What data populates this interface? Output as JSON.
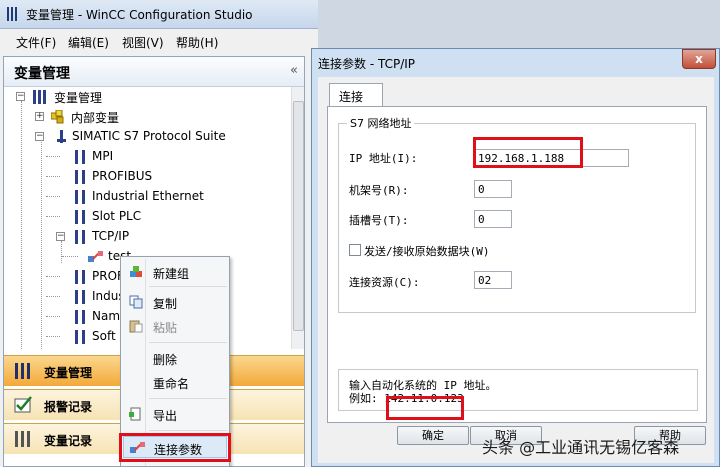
{
  "window": {
    "title": "变量管理 - WinCC Configuration Studio",
    "menu": [
      "文件(F)",
      "编辑(E)",
      "视图(V)",
      "帮助(H)"
    ]
  },
  "left_pane": {
    "title": "变量管理",
    "collapse_glyph": "«",
    "tree": [
      {
        "label": "变量管理",
        "icon": "tag-management-icon"
      },
      {
        "label": "内部变量",
        "icon": "internal-tags-icon"
      },
      {
        "label": "SIMATIC S7 Protocol Suite",
        "icon": "driver-icon"
      },
      {
        "label": "MPI",
        "icon": "channel-unit-icon"
      },
      {
        "label": "PROFIBUS",
        "icon": "channel-unit-icon"
      },
      {
        "label": "Industrial Ethernet",
        "icon": "channel-unit-icon"
      },
      {
        "label": "Slot PLC",
        "icon": "channel-unit-icon"
      },
      {
        "label": "TCP/IP",
        "icon": "channel-unit-icon"
      },
      {
        "label": "test",
        "icon": "connection-icon"
      },
      {
        "label": "PROF",
        "icon": "channel-unit-icon"
      },
      {
        "label": "Indus",
        "icon": "channel-unit-icon"
      },
      {
        "label": "Name",
        "icon": "channel-unit-icon"
      },
      {
        "label": "Soft P",
        "icon": "channel-unit-icon"
      }
    ],
    "nav": [
      {
        "label": "变量管理",
        "icon": "tag-management-icon"
      },
      {
        "label": "报警记录",
        "icon": "alarm-logging-icon"
      },
      {
        "label": "变量记录",
        "icon": "tag-logging-icon"
      }
    ]
  },
  "context_menu": {
    "items": [
      {
        "label": "新建组",
        "icon": "new-group-icon",
        "enabled": true
      },
      {
        "label": "复制",
        "icon": "copy-icon",
        "enabled": true
      },
      {
        "label": "粘贴",
        "icon": "paste-icon",
        "enabled": false
      },
      {
        "label": "删除",
        "icon": "",
        "enabled": true
      },
      {
        "label": "重命名",
        "icon": "",
        "enabled": true
      },
      {
        "label": "导出",
        "icon": "export-icon",
        "enabled": true
      },
      {
        "label": "连接参数",
        "icon": "connection-params-icon",
        "enabled": true,
        "highlighted": true
      }
    ]
  },
  "dialog": {
    "title": "连接参数 - TCP/IP",
    "close_glyph": "x",
    "tab": "连接",
    "group_title": "S7 网络地址",
    "fields": {
      "ip_label": "IP 地址(I):",
      "ip_value": "192.168.1.188",
      "rack_label": "机架号(R):",
      "rack_value": "0",
      "slot_label": "插槽号(T):",
      "slot_value": "0",
      "raw_label": "发送/接收原始数据块(W)",
      "raw_checked": false,
      "resource_label": "连接资源(C):",
      "resource_value": "02"
    },
    "hint_line1": "输入自动化系统的 IP 地址。",
    "hint_line2": "例如: 142.11.0.123",
    "buttons": {
      "ok": "确定",
      "cancel": "取消",
      "help": "帮助"
    }
  },
  "watermark": "头条 @工业通讯无锡亿客森",
  "colors": {
    "highlight": "#e0101a",
    "nav_active": "#f6b548"
  }
}
